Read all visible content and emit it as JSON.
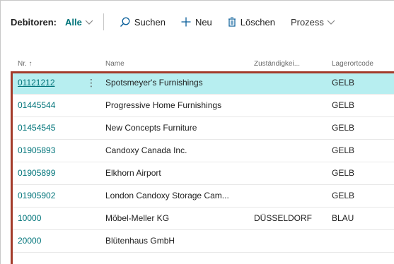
{
  "toolbar": {
    "title": "Debitoren:",
    "filter": "Alle",
    "search": "Suchen",
    "new": "Neu",
    "delete": "Löschen",
    "process": "Prozess"
  },
  "columns": {
    "nr": "Nr. ↑",
    "name": "Name",
    "responsibility": "Zuständigkei...",
    "location": "Lagerortcode"
  },
  "rows": [
    {
      "nr": "01121212",
      "name": "Spotsmeyer's Furnishings",
      "responsibility": "",
      "location": "GELB",
      "menu": "⋮"
    },
    {
      "nr": "01445544",
      "name": "Progressive Home Furnishings",
      "responsibility": "",
      "location": "GELB"
    },
    {
      "nr": "01454545",
      "name": "New Concepts Furniture",
      "responsibility": "",
      "location": "GELB"
    },
    {
      "nr": "01905893",
      "name": "Candoxy Canada Inc.",
      "responsibility": "",
      "location": "GELB"
    },
    {
      "nr": "01905899",
      "name": "Elkhorn Airport",
      "responsibility": "",
      "location": "GELB"
    },
    {
      "nr": "01905902",
      "name": "London Candoxy Storage Cam...",
      "responsibility": "",
      "location": "GELB"
    },
    {
      "nr": "10000",
      "name": "Möbel-Meller KG",
      "responsibility": "DÜSSELDORF",
      "location": "BLAU"
    },
    {
      "nr": "20000",
      "name": "Blütenhaus GmbH",
      "responsibility": "",
      "location": ""
    }
  ],
  "colors": {
    "accent": "#00747a",
    "selected_row": "#b7eef0",
    "outline": "#a33b2a"
  }
}
